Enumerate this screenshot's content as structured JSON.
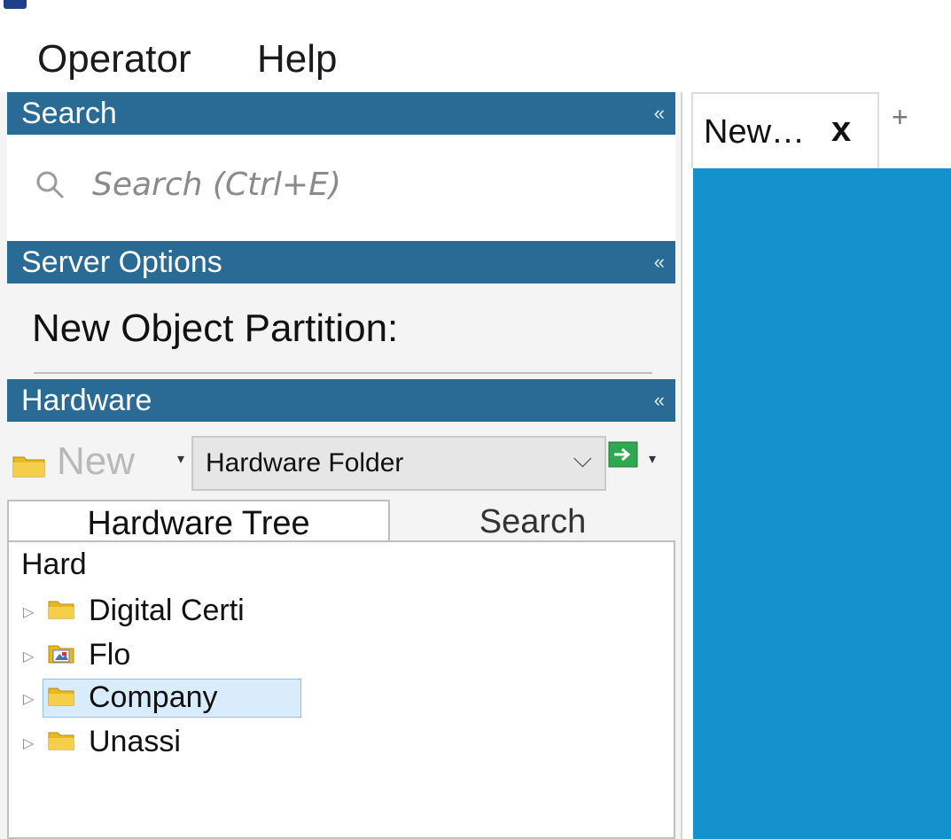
{
  "menu": {
    "items": [
      {
        "label": "Operator"
      },
      {
        "label": "Help"
      }
    ]
  },
  "panels": {
    "search": {
      "title": "Search",
      "collapse_glyph": "«",
      "placeholder": "Search (Ctrl+E)"
    },
    "server_options": {
      "title": "Server Options",
      "collapse_glyph": "«",
      "partition_label": "New Object Partition:"
    },
    "hardware": {
      "title": "Hardware",
      "collapse_glyph": "«",
      "new_label": "New",
      "type_select_value": "Hardware Folder",
      "tabs": [
        {
          "label": "Hardware Tree",
          "active": true
        },
        {
          "label": "Search",
          "active": false
        }
      ],
      "tree": {
        "root_label": "Hard",
        "items": [
          {
            "label": "Digital Certi",
            "icon": "folder-icon",
            "selected": false
          },
          {
            "label": "Flo",
            "icon": "floorplan-icon",
            "selected": false
          },
          {
            "label": "Company",
            "icon": "folder-icon",
            "selected": true
          },
          {
            "label": "Unassi",
            "icon": "folder-icon",
            "selected": false
          }
        ]
      }
    }
  },
  "document_tabs": [
    {
      "label": "New…",
      "close_glyph": "x"
    }
  ],
  "add_tab_glyph": "+",
  "colors": {
    "header_blue": "#2a6b96",
    "content_blue": "#1492ce",
    "folder_yellow": "#e8b820",
    "selection_bg": "#d9ecfb"
  }
}
